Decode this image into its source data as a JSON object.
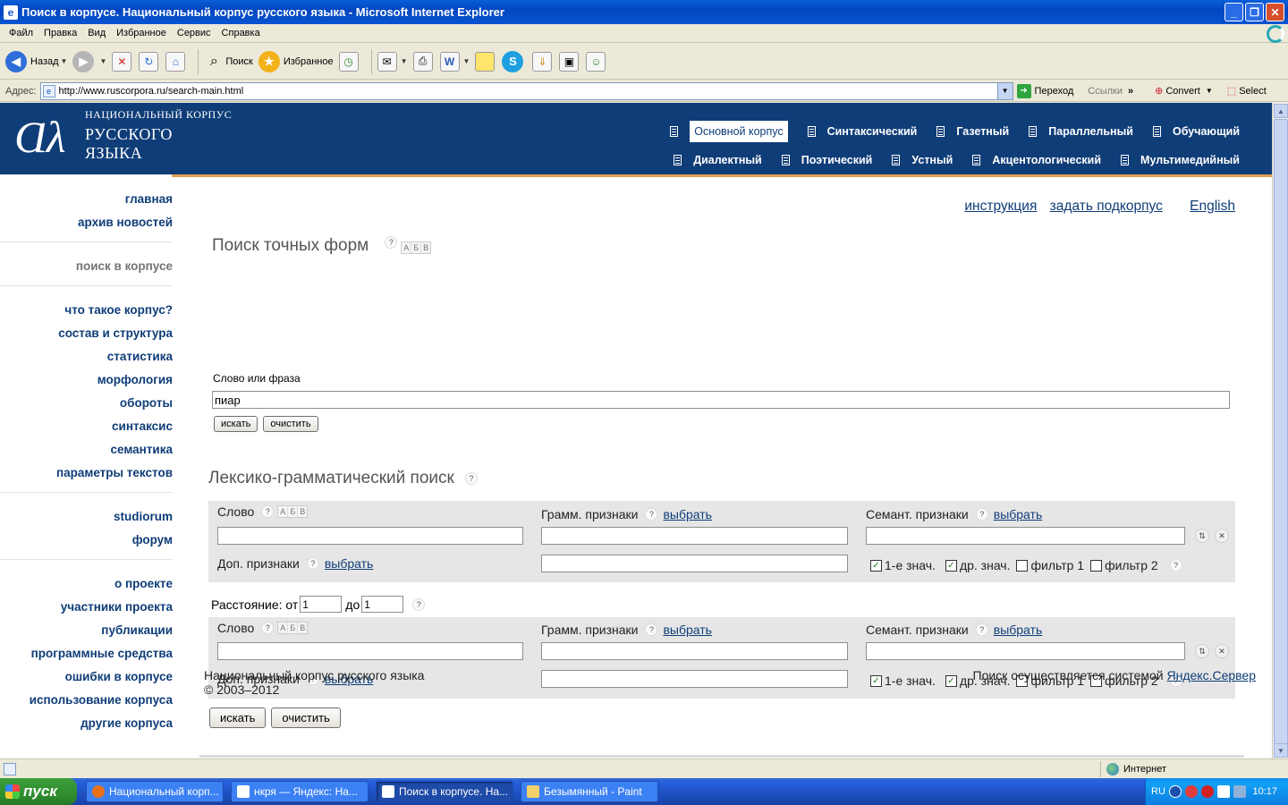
{
  "window": {
    "title": "Поиск в корпусе. Национальный корпус русского языка - Microsoft Internet Explorer"
  },
  "menu": [
    "Файл",
    "Правка",
    "Вид",
    "Избранное",
    "Сервис",
    "Справка"
  ],
  "toolbar": {
    "back": "Назад",
    "search": "Поиск",
    "favorites": "Избранное"
  },
  "address": {
    "label": "Адрес:",
    "url": "http://www.ruscorpora.ru/search-main.html",
    "go": "Переход",
    "links": "Ссылки",
    "convert": "Convert",
    "select": "Select"
  },
  "site": {
    "logo_line1": "НАЦИОНАЛЬНЫЙ КОРПУС",
    "logo_line2": "РУССКОГО",
    "logo_line3": "ЯЗЫКА",
    "corpora_row1": [
      "Основной корпус",
      "Синтаксический",
      "Газетный",
      "Параллельный",
      "Обучающий"
    ],
    "corpora_row2": [
      "Диалектный",
      "Поэтический",
      "Устный",
      "Акцентологический",
      "Мультимедийный"
    ]
  },
  "sidebar": {
    "group1": [
      "главная",
      "архив новостей"
    ],
    "group2": [
      "поиск в корпусе"
    ],
    "group3": [
      "что такое корпус?",
      "состав и структура",
      "статистика",
      "морфология",
      "обороты",
      "синтаксис",
      "семантика",
      "параметры текстов"
    ],
    "group4": [
      "studiorum",
      "форум"
    ],
    "group5": [
      "о проекте",
      "участники проекта",
      "публикации",
      "программные средства",
      "ошибки в корпусе",
      "использование корпуса",
      "другие корпуса"
    ]
  },
  "top_links": {
    "instruction": "инструкция",
    "subcorpus": "задать подкорпус",
    "english": "English"
  },
  "exact": {
    "title": "Поиск точных форм",
    "label": "Слово или фраза",
    "value": "пиар",
    "search_btn": "искать",
    "clear_btn": "очистить"
  },
  "abv": [
    "А",
    "Б",
    "В"
  ],
  "lex": {
    "title": "Лексико-грамматический поиск",
    "word_label": "Слово",
    "gram_label": "Грамм. признаки",
    "sem_label": "Семант. признаки",
    "extra_label": "Доп. признаки",
    "choose": "выбрать",
    "check_first": "1-е знач.",
    "check_other": "др. знач.",
    "check_f1": "фильтр 1",
    "check_f2": "фильтр 2",
    "distance_label": "Расстояние: от",
    "distance_to": "до",
    "distance_from_val": "1",
    "distance_to_val": "1",
    "search_btn": "искать",
    "clear_btn": "очистить"
  },
  "footer": {
    "name": "Национальный корпус русского языка",
    "years": "© 2003–2012",
    "powered": "Поиск осуществляется системой",
    "engine": "Яндекс.Сервер"
  },
  "status": {
    "zone": "Интернет"
  },
  "taskbar": {
    "start": "пуск",
    "tasks": [
      "Национальный корп...",
      "нкря — Яндекс: На...",
      "Поиск в корпусе. На...",
      "Безымянный - Paint"
    ],
    "lang": "RU",
    "clock": "10:17"
  },
  "colors": {
    "site_blue": "#0f3d78",
    "accent_orange": "#e2a150",
    "xp_blue": "#0a5fd8"
  }
}
